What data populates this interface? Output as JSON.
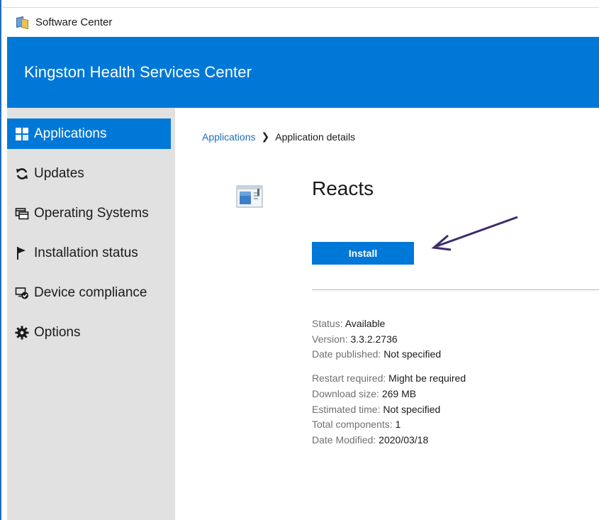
{
  "window": {
    "title": "Software Center"
  },
  "banner": {
    "title": "Kingston Health Services Center"
  },
  "sidebar": {
    "items": [
      {
        "label": "Applications",
        "icon": "applications-grid-icon",
        "active": true
      },
      {
        "label": "Updates",
        "icon": "refresh-icon",
        "active": false
      },
      {
        "label": "Operating Systems",
        "icon": "windows-stack-icon",
        "active": false
      },
      {
        "label": "Installation status",
        "icon": "flag-icon",
        "active": false
      },
      {
        "label": "Device compliance",
        "icon": "device-check-icon",
        "active": false
      },
      {
        "label": "Options",
        "icon": "gear-icon",
        "active": false
      }
    ]
  },
  "breadcrumb": {
    "parent": "Applications",
    "separator": "❯",
    "current": "Application details"
  },
  "app": {
    "name": "Reacts",
    "install_label": "Install"
  },
  "details": {
    "group1": [
      {
        "label": "Status:",
        "value": "Available"
      },
      {
        "label": "Version:",
        "value": "3.3.2.2736"
      },
      {
        "label": "Date published:",
        "value": "Not specified"
      }
    ],
    "group2": [
      {
        "label": "Restart required:",
        "value": "Might be required"
      },
      {
        "label": "Download size:",
        "value": "269 MB"
      },
      {
        "label": "Estimated time:",
        "value": "Not specified"
      },
      {
        "label": "Total components:",
        "value": "1"
      },
      {
        "label": "Date Modified:",
        "value": "2020/03/18"
      }
    ]
  },
  "colors": {
    "accent": "#0078d7",
    "sidebar_bg": "#e1e1e1",
    "annotation_arrow": "#3d2a6b"
  }
}
